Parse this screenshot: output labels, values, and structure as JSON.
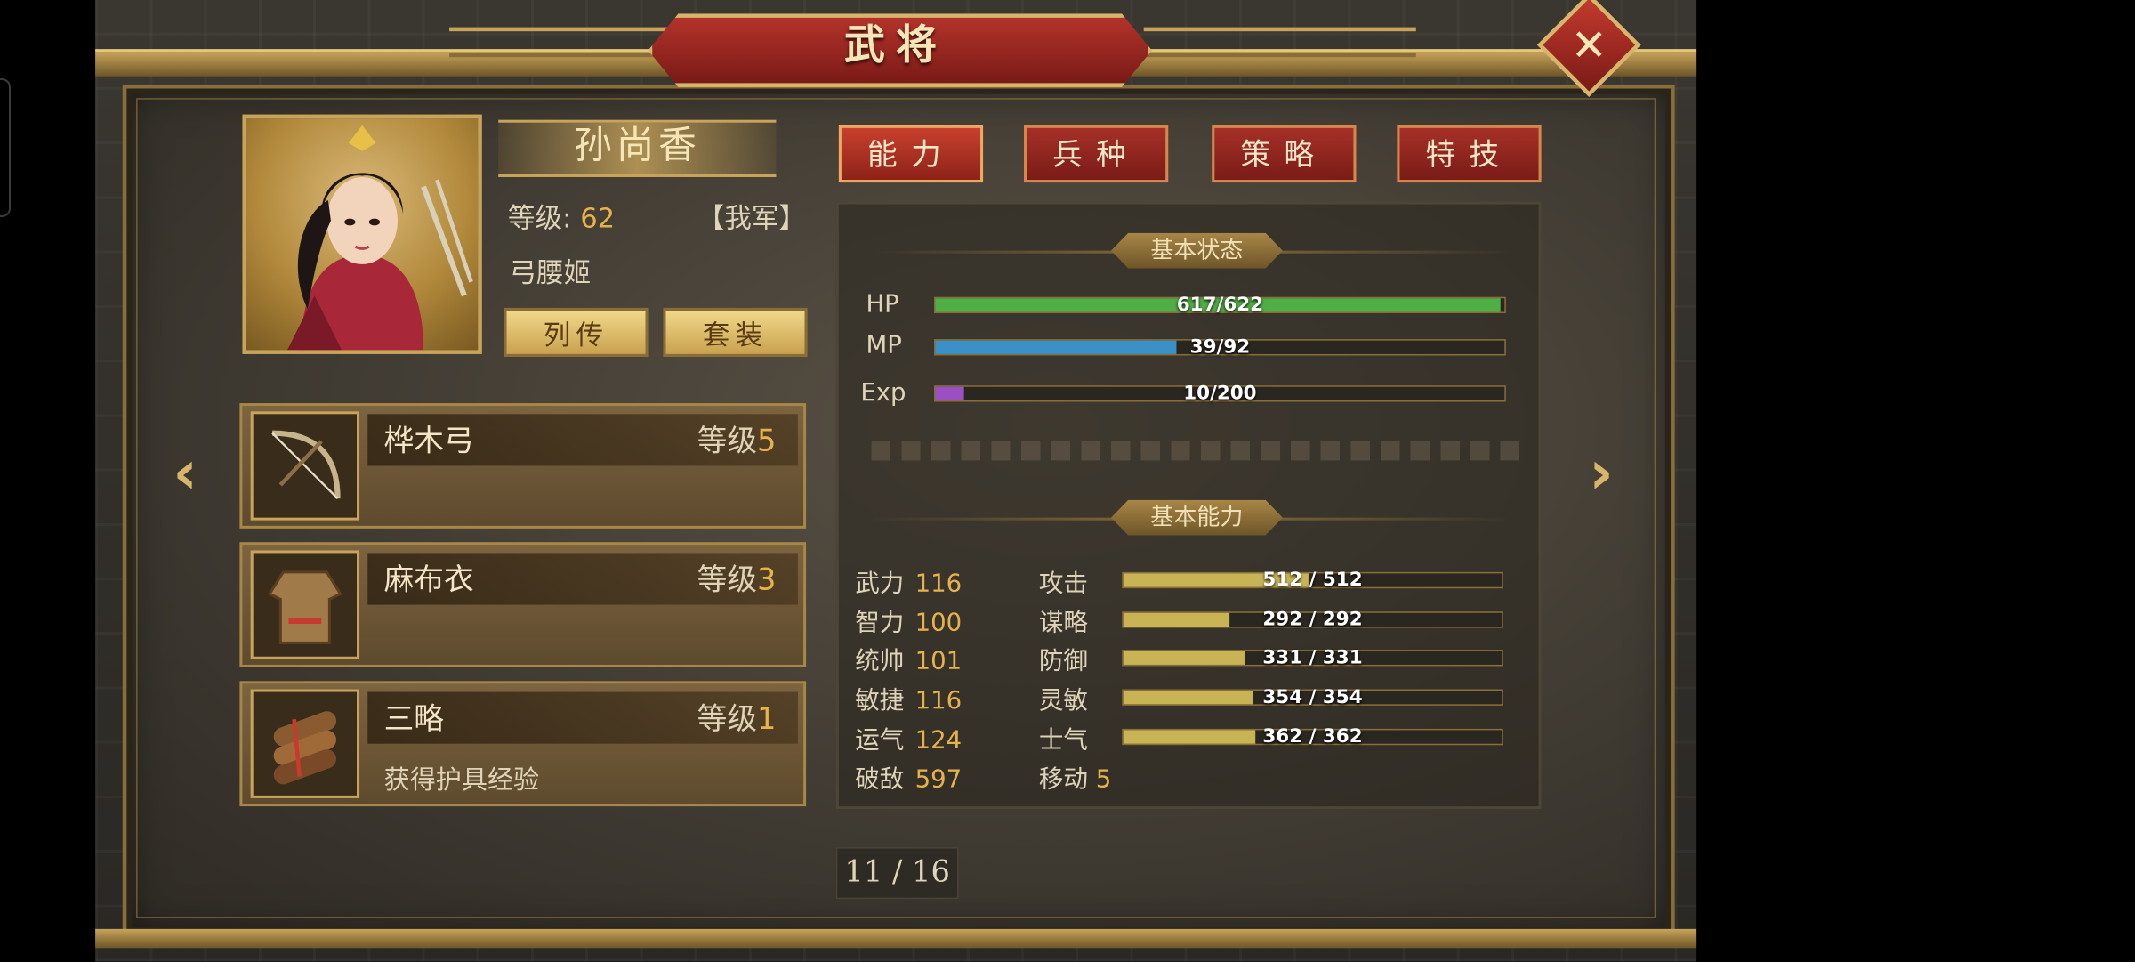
{
  "window": {
    "title": "武将",
    "close_icon": "close-icon"
  },
  "hero": {
    "name": "孙尚香",
    "level_label": "等级:",
    "level": "62",
    "faction": "【我军】",
    "class": "弓腰姬",
    "buttons": {
      "biography": "列传",
      "set": "套装"
    }
  },
  "tabs": [
    {
      "label": "能力",
      "active": true
    },
    {
      "label": "兵种",
      "active": false
    },
    {
      "label": "策略",
      "active": false
    },
    {
      "label": "特技",
      "active": false
    }
  ],
  "equipment": [
    {
      "name": "桦木弓",
      "level_label": "等级",
      "level": "5",
      "desc": "",
      "icon": "bow-icon"
    },
    {
      "name": "麻布衣",
      "level_label": "等级",
      "level": "3",
      "desc": "",
      "icon": "armor-icon"
    },
    {
      "name": "三略",
      "level_label": "等级",
      "level": "1",
      "desc": "获得护具经验",
      "icon": "scroll-icon"
    }
  ],
  "basic_status": {
    "heading": "基本状态",
    "bars": [
      {
        "label": "HP",
        "text": "617/622",
        "fraction": 0.992,
        "color": "#4fae45"
      },
      {
        "label": "MP",
        "text": "39/92",
        "fraction": 0.424,
        "color": "#3c90c8"
      },
      {
        "label": "Exp",
        "text": "10/200",
        "fraction": 0.05,
        "color": "#9a4fc4"
      }
    ]
  },
  "basic_ability": {
    "heading": "基本能力",
    "attributes": [
      {
        "label": "武力",
        "value": "116"
      },
      {
        "label": "智力",
        "value": "100"
      },
      {
        "label": "统帅",
        "value": "101"
      },
      {
        "label": "敏捷",
        "value": "116"
      },
      {
        "label": "运气",
        "value": "124"
      },
      {
        "label": "破敌",
        "value": "597"
      }
    ],
    "combat": [
      {
        "label": "攻击",
        "text": "512 / 512",
        "fraction": 0.49
      },
      {
        "label": "谋略",
        "text": "292 / 292",
        "fraction": 0.28
      },
      {
        "label": "防御",
        "text": "331 / 331",
        "fraction": 0.32
      },
      {
        "label": "灵敏",
        "text": "354 / 354",
        "fraction": 0.34
      },
      {
        "label": "士气",
        "text": "362 / 362",
        "fraction": 0.35
      }
    ],
    "move": {
      "label": "移动",
      "value": "5"
    },
    "bar_color": "#c9b455"
  },
  "pagination": {
    "text": "11 / 16"
  }
}
